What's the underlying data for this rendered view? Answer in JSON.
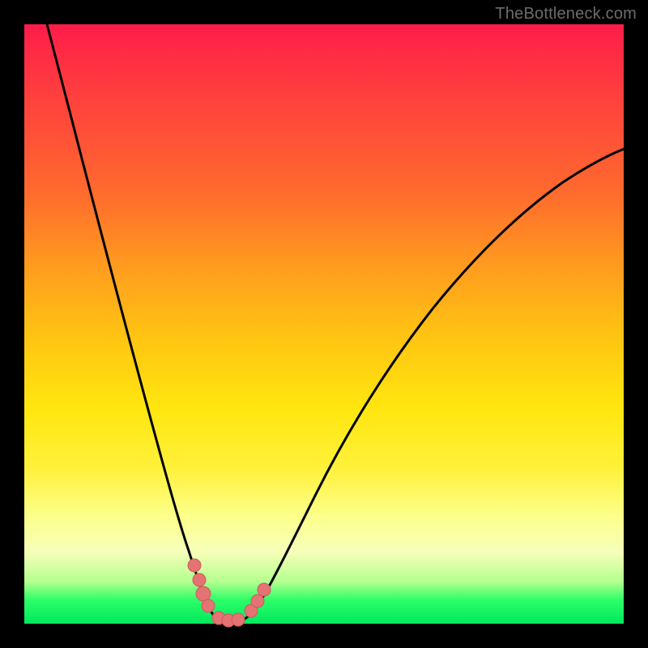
{
  "watermark": "TheBottleneck.com",
  "chart_data": {
    "type": "line",
    "title": "",
    "xlabel": "",
    "ylabel": "",
    "xlim": [
      0,
      100
    ],
    "ylim": [
      0,
      100
    ],
    "series": [
      {
        "name": "curve",
        "x": [
          0,
          5,
          10,
          15,
          20,
          24,
          26,
          27,
          28,
          29,
          30,
          31,
          32,
          33,
          34,
          35,
          36,
          38,
          40,
          45,
          50,
          55,
          60,
          65,
          70,
          75,
          80,
          85,
          90,
          95,
          100
        ],
        "values": [
          100,
          90,
          78,
          64,
          47,
          27,
          16,
          11,
          8,
          5,
          3,
          1,
          0,
          0,
          0,
          1,
          2,
          5,
          9,
          19,
          28,
          36,
          43,
          49,
          55,
          60,
          64,
          68,
          72,
          75,
          77
        ]
      },
      {
        "name": "markers",
        "x": [
          26,
          27,
          28,
          29,
          32,
          33,
          34,
          36,
          37,
          38
        ],
        "values": [
          16,
          11,
          8,
          5,
          0,
          0,
          0,
          2,
          3,
          5
        ]
      }
    ],
    "colors": {
      "curve": "#000000",
      "markers_fill": "#e57373",
      "markers_stroke": "#cc5a5a"
    }
  }
}
